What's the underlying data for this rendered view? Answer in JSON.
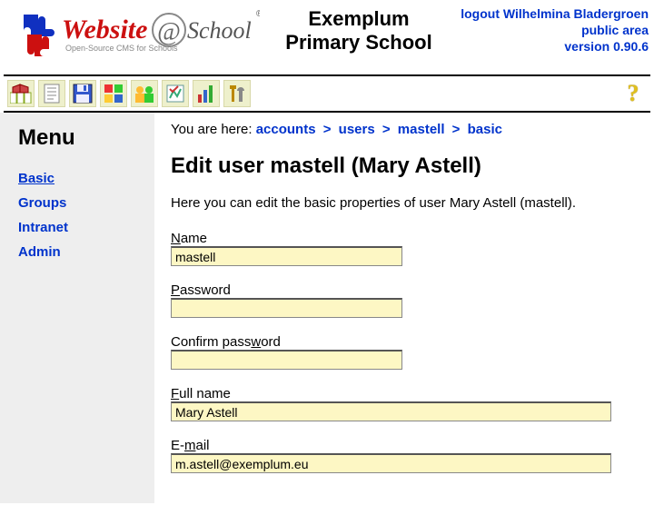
{
  "header": {
    "logo_main": "Website",
    "logo_at": "@",
    "logo_school": "School",
    "logo_tag": "Open-Source CMS for Schools",
    "title_line1": "Exemplum",
    "title_line2": "Primary School",
    "logout": "logout Wilhelmina Bladergroen",
    "public_area": "public area",
    "version": "version 0.90.6"
  },
  "toolbar": {
    "help": "?"
  },
  "sidebar": {
    "title": "Menu",
    "items": [
      {
        "label": "Basic",
        "active": true
      },
      {
        "label": "Groups"
      },
      {
        "label": "Intranet"
      },
      {
        "label": "Admin"
      }
    ]
  },
  "breadcrumb": {
    "prefix": "You are here: ",
    "parts": [
      "accounts",
      "users",
      "mastell",
      "basic"
    ],
    "sep": ">"
  },
  "page": {
    "heading": "Edit user mastell (Mary Astell)",
    "intro": "Here you can edit the basic properties of user Mary Astell (mastell)."
  },
  "form": {
    "name": {
      "label_pre": "N",
      "label_rest": "ame",
      "value": "mastell"
    },
    "password": {
      "label_pre": "P",
      "label_rest": "assword",
      "value": ""
    },
    "confirm": {
      "label_pre": "Confirm pass",
      "label_mid": "w",
      "label_rest": "ord",
      "value": ""
    },
    "fullname": {
      "label_pre": "F",
      "label_rest": "ull name",
      "value": "Mary Astell"
    },
    "email": {
      "label_pre": "E-",
      "label_mid": "m",
      "label_rest": "ail",
      "value": "m.astell@exemplum.eu"
    }
  }
}
